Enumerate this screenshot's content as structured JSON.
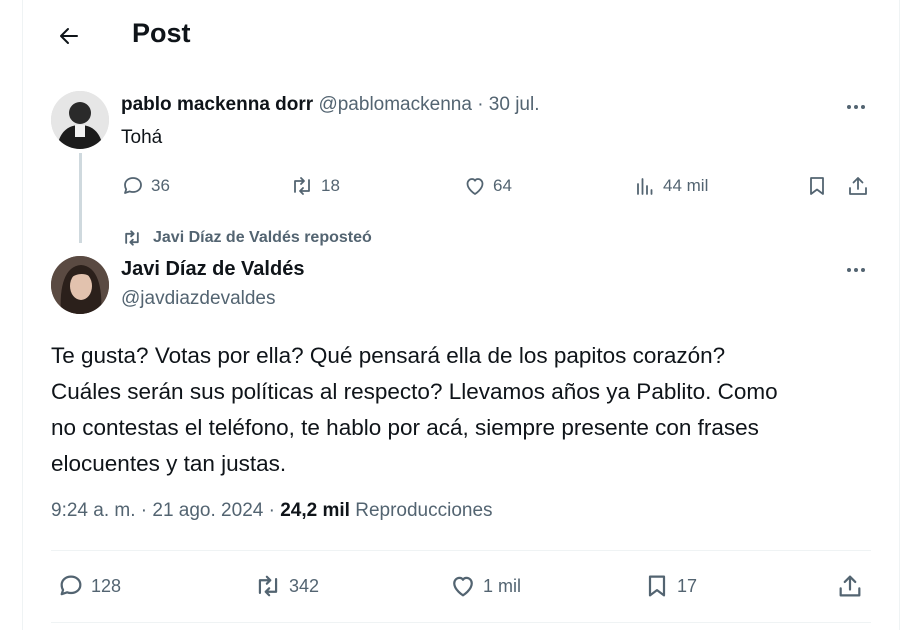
{
  "header": {
    "title": "Post",
    "back_icon": "arrow-left-icon"
  },
  "original_post": {
    "author_name": "pablo mackenna dorr",
    "handle": "@pablomackenna",
    "separator": "·",
    "date": "30 jul.",
    "text": "Tohá",
    "actions": {
      "replies": "36",
      "reposts": "18",
      "likes": "64",
      "views": "44 mil"
    }
  },
  "repost_banner": {
    "label": "Javi Díaz de Valdés reposteó",
    "icon": "repost-icon"
  },
  "main_post": {
    "author_name": "Javi Díaz de Valdés",
    "handle": "@javdiazdevaldes",
    "text_lines": [
      "Te gusta? Votas por ella? Qué pensará ella de los papitos corazón?",
      "Cuáles serán sus políticas al respecto? Llevamos años ya Pablito. Como",
      "no contestas el teléfono, te hablo por acá, siempre presente con frases",
      "elocuentes y tan justas."
    ],
    "time": "9:24 a. m.",
    "date": "21 ago. 2024",
    "views_count": "24,2 mil",
    "views_label": "Reproducciones",
    "dot": "·",
    "actions": {
      "replies": "128",
      "reposts": "342",
      "likes": "1 mil",
      "bookmarks": "17"
    }
  },
  "colors": {
    "text": "#0f1419",
    "muted": "#536471",
    "divider": "#eff3f4"
  }
}
